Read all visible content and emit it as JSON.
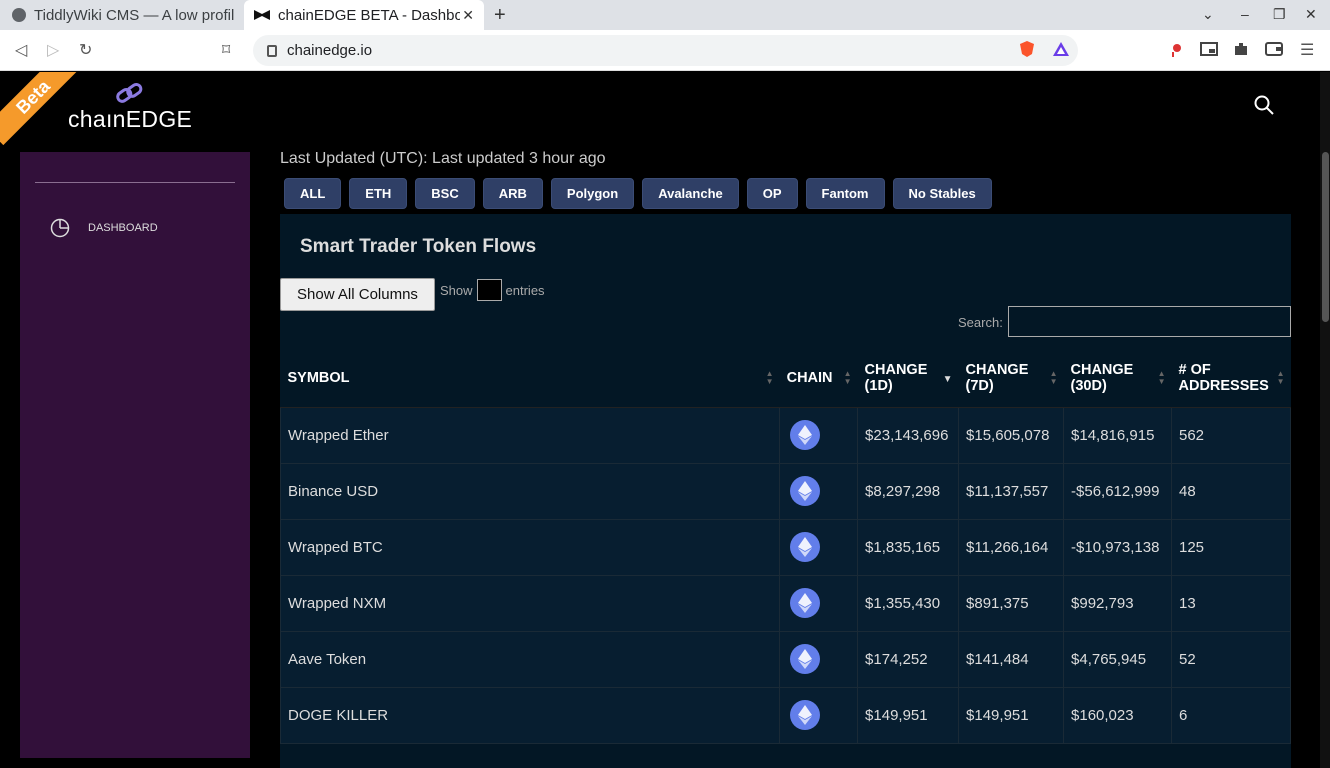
{
  "browser": {
    "tabs": [
      {
        "title": "TiddlyWiki CMS — A low profil"
      },
      {
        "title": "chainEDGE BETA - Dashboa"
      }
    ],
    "url": "chainedge.io"
  },
  "site": {
    "badge": "Beta",
    "logo_text": "chaınEDGE"
  },
  "sidebar": {
    "items": [
      {
        "label": "DASHBOARD",
        "icon": "pie-chart-icon"
      }
    ]
  },
  "status": {
    "last_updated": "Last Updated (UTC): Last updated 3 hour ago"
  },
  "filters": [
    "ALL",
    "ETH",
    "BSC",
    "ARB",
    "Polygon",
    "Avalanche",
    "OP",
    "Fantom",
    "No Stables"
  ],
  "panel": {
    "title": "Smart Trader Token Flows",
    "show_all_columns": "Show All Columns",
    "show_label": "Show",
    "entries_label": "entries",
    "search_label": "Search:"
  },
  "table": {
    "headers": [
      "SYMBOL",
      "CHAIN",
      "CHANGE (1D)",
      "CHANGE (7D)",
      "CHANGE (30D)",
      "# OF ADDRESSES"
    ],
    "rows": [
      {
        "symbol": "Wrapped Ether",
        "chain": "eth",
        "d1": "$23,143,696",
        "d7": "$15,605,078",
        "d30": "$14,816,915",
        "addresses": "562"
      },
      {
        "symbol": "Binance USD",
        "chain": "eth",
        "d1": "$8,297,298",
        "d7": "$11,137,557",
        "d30": "-$56,612,999",
        "addresses": "48"
      },
      {
        "symbol": "Wrapped BTC",
        "chain": "eth",
        "d1": "$1,835,165",
        "d7": "$11,266,164",
        "d30": "-$10,973,138",
        "addresses": "125"
      },
      {
        "symbol": "Wrapped NXM",
        "chain": "eth",
        "d1": "$1,355,430",
        "d7": "$891,375",
        "d30": "$992,793",
        "addresses": "13"
      },
      {
        "symbol": "Aave Token",
        "chain": "eth",
        "d1": "$174,252",
        "d7": "$141,484",
        "d30": "$4,765,945",
        "addresses": "52"
      },
      {
        "symbol": "DOGE KILLER",
        "chain": "eth",
        "d1": "$149,951",
        "d7": "$149,951",
        "d30": "$160,023",
        "addresses": "6"
      }
    ]
  }
}
